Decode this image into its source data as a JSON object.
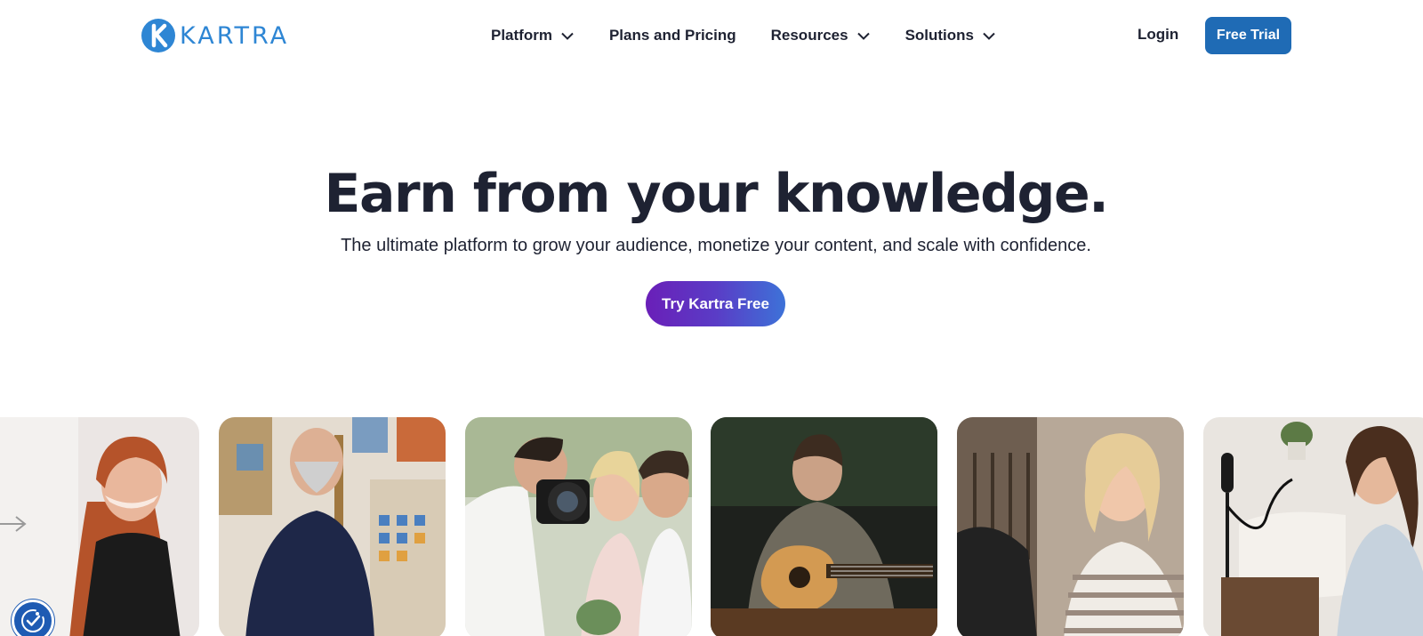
{
  "brand": {
    "name": "KARTRA",
    "color": "#2e86d4"
  },
  "nav": {
    "items": [
      {
        "label": "Platform",
        "has_dropdown": true
      },
      {
        "label": "Plans and Pricing",
        "has_dropdown": false
      },
      {
        "label": "Resources",
        "has_dropdown": true
      },
      {
        "label": "Solutions",
        "has_dropdown": true
      }
    ],
    "login_label": "Login",
    "free_trial_label": "Free Trial",
    "free_trial_color": "#1f6bb5"
  },
  "hero": {
    "title": "Earn from your knowledge.",
    "subtitle": "The ultimate platform to grow your audience, monetize your content, and scale with confidence.",
    "cta_label": "Try Kartra Free",
    "cta_gradient": [
      "#6a1fb8",
      "#3d72d8"
    ]
  },
  "photos": [
    {
      "icon": "presenter-photo"
    },
    {
      "icon": "painter-photo"
    },
    {
      "icon": "photographer-photo"
    },
    {
      "icon": "guitarist-photo"
    },
    {
      "icon": "smiling-woman-photo"
    },
    {
      "icon": "podcaster-photo"
    }
  ],
  "accessibility_button": {
    "icon": "accessibility-icon",
    "color": "#1e5bb3"
  }
}
